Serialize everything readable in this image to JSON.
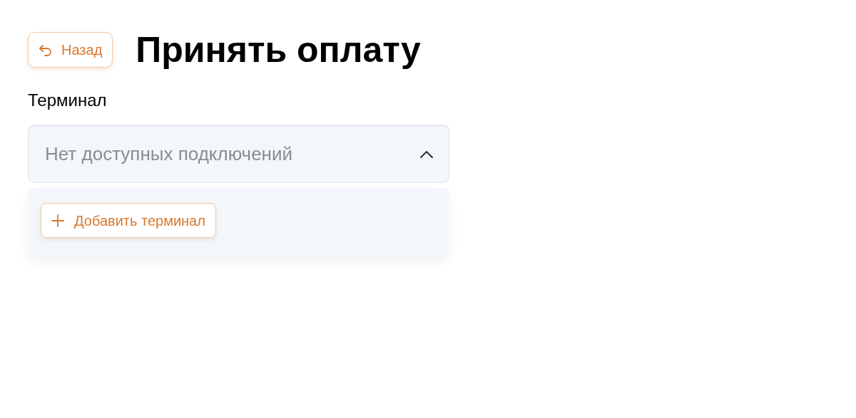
{
  "back_button": {
    "label": "Назад"
  },
  "title": "Принять оплату",
  "terminal_field": {
    "label": "Терминал",
    "placeholder": "Нет доступных подключений",
    "expanded": true
  },
  "dropdown": {
    "add_button": {
      "label": "Добавить терминал"
    }
  }
}
